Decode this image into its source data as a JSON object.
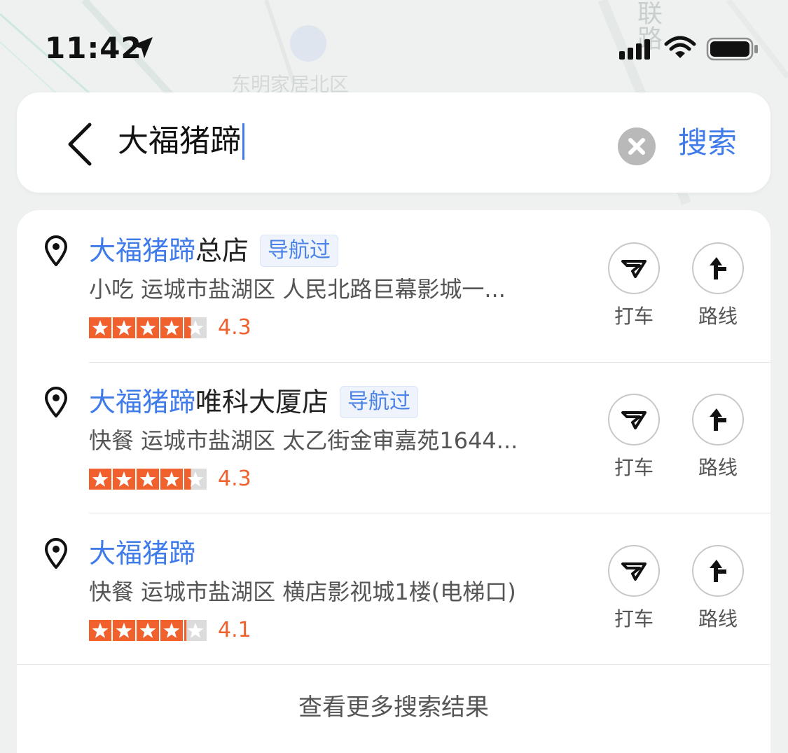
{
  "status_bar": {
    "time": "11:42"
  },
  "map_labels": {
    "road": "联路"
  },
  "search": {
    "query": "大福猪蹄",
    "search_label": "搜索"
  },
  "results": [
    {
      "title_highlight": "大福猪蹄",
      "title_rest": "总店",
      "tag": "导航过",
      "address": "小吃  运城市盐湖区 人民北路巨幕影城一...",
      "rating": "4.3",
      "rating_value": 4.3,
      "taxi_label": "打车",
      "route_label": "路线"
    },
    {
      "title_highlight": "大福猪蹄",
      "title_rest": "唯科大厦店",
      "tag": "导航过",
      "address": "快餐  运城市盐湖区 太乙街金审嘉苑1644...",
      "rating": "4.3",
      "rating_value": 4.3,
      "taxi_label": "打车",
      "route_label": "路线"
    },
    {
      "title_highlight": "大福猪蹄",
      "title_rest": "",
      "tag": "",
      "address": "快餐  运城市盐湖区 横店影视城1楼(电梯口)",
      "rating": "4.1",
      "rating_value": 4.1,
      "taxi_label": "打车",
      "route_label": "路线"
    }
  ],
  "more_results_label": "查看更多搜索结果",
  "colors": {
    "accent": "#3f7bea",
    "rating": "#f0612d",
    "star": "#f0612d"
  },
  "icons": [
    "location-arrow-icon",
    "signal-icon",
    "wifi-icon",
    "battery-icon",
    "back-icon",
    "clear-icon",
    "pin-icon",
    "taxi-icon",
    "route-icon",
    "star-icon"
  ]
}
